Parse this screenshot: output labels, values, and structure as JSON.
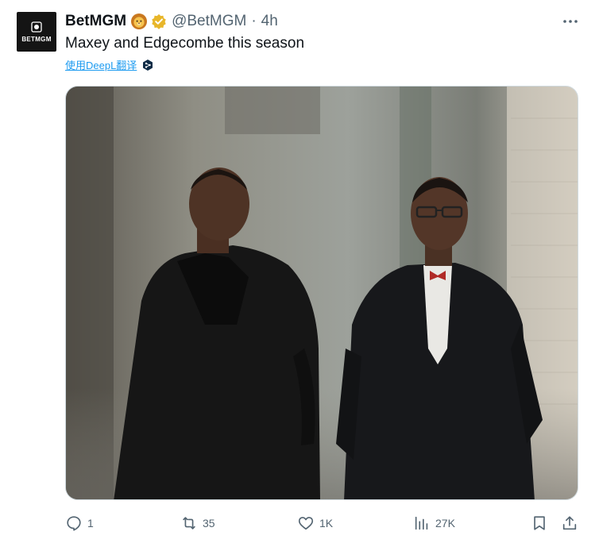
{
  "author": {
    "name": "BetMGM",
    "handle": "@BetMGM",
    "time_separator": "·",
    "time": "4h",
    "avatar_text": "BETMGM",
    "emoji_icon": "lion-face-icon",
    "verified_icon": "verified-gold-badge-icon"
  },
  "tweet": {
    "text": "Maxey and Edgecombe this season",
    "translate_label": "使用DeepL翻译"
  },
  "actions": {
    "replies": "1",
    "retweets": "35",
    "likes": "1K",
    "views": "27K"
  },
  "colors": {
    "text": "#0f1419",
    "secondary": "#536471",
    "link": "#1d9bf0",
    "verified_gold": "#e8b62a"
  }
}
